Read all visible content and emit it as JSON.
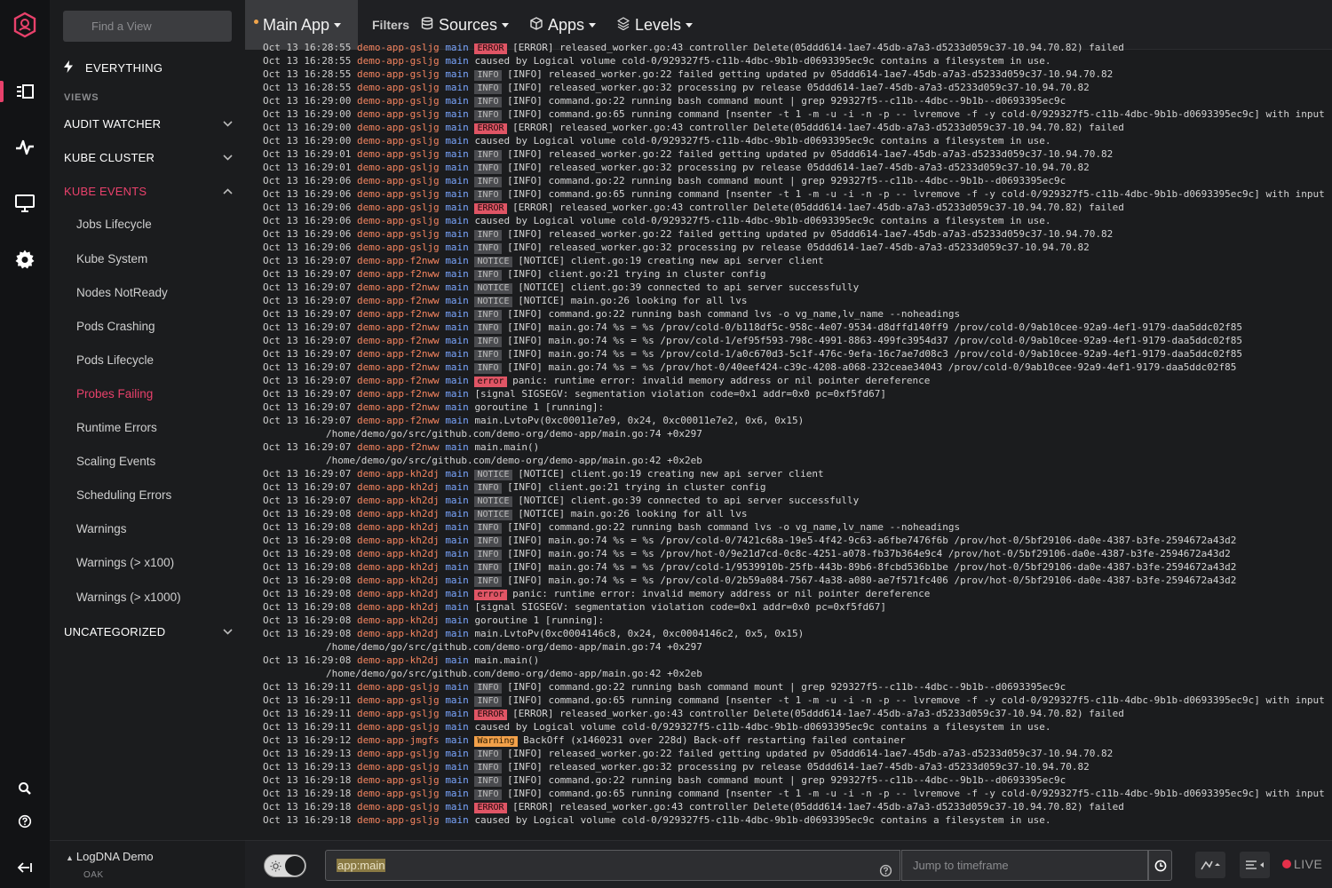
{
  "nav": {
    "find_placeholder": "Find a View",
    "everything_label": "EVERYTHING",
    "views_header": "VIEWS"
  },
  "categories": [
    {
      "label": "AUDIT WATCHER",
      "open": false
    },
    {
      "label": "KUBE CLUSTER",
      "open": false
    },
    {
      "label": "KUBE EVENTS",
      "open": true
    },
    {
      "label": "UNCATEGORIZED",
      "open": false
    }
  ],
  "kube_events_views": [
    {
      "label": "Jobs Lifecycle"
    },
    {
      "label": "Kube System"
    },
    {
      "label": "Nodes NotReady"
    },
    {
      "label": "Pods Crashing"
    },
    {
      "label": "Pods Lifecycle"
    },
    {
      "label": "Probes Failing",
      "active": true
    },
    {
      "label": "Runtime Errors"
    },
    {
      "label": "Scaling Events"
    },
    {
      "label": "Scheduling Errors"
    },
    {
      "label": "Warnings"
    },
    {
      "label": "Warnings (> x100)"
    },
    {
      "label": "Warnings (> x1000)"
    }
  ],
  "account": {
    "name": "LogDNA Demo",
    "region": "OAK"
  },
  "topbar": {
    "view_name": "Main App",
    "filters_label": "Filters",
    "sources_label": "Sources",
    "apps_label": "Apps",
    "levels_label": "Levels"
  },
  "logs": [
    {
      "ts": "Oct 13 16:28:55",
      "host": "demo-app-gsljg",
      "app": "main",
      "level": "ERROR",
      "msg": "[ERROR] released_worker.go:43 controller Delete(05ddd614-1ae7-45db-a7a3-d5233d059c37-10.94.70.82) failed"
    },
    {
      "ts": "Oct 13 16:28:55",
      "host": "demo-app-gsljg",
      "app": "main",
      "level": "",
      "msg": "caused by   Logical volume cold-0/929327f5-c11b-4dbc-9b1b-d0693395ec9c contains a filesystem in use."
    },
    {
      "ts": "Oct 13 16:28:55",
      "host": "demo-app-gsljg",
      "app": "main",
      "level": "INFO",
      "msg": "[INFO] released_worker.go:22 failed getting updated pv 05ddd614-1ae7-45db-a7a3-d5233d059c37-10.94.70.82"
    },
    {
      "ts": "Oct 13 16:28:55",
      "host": "demo-app-gsljg",
      "app": "main",
      "level": "INFO",
      "msg": "[INFO] released_worker.go:32 processing pv release 05ddd614-1ae7-45db-a7a3-d5233d059c37-10.94.70.82"
    },
    {
      "ts": "Oct 13 16:29:00",
      "host": "demo-app-gsljg",
      "app": "main",
      "level": "INFO",
      "msg": "[INFO] command.go:22 running bash command mount | grep 929327f5--c11b--4dbc--9b1b--d0693395ec9c"
    },
    {
      "ts": "Oct 13 16:29:00",
      "host": "demo-app-gsljg",
      "app": "main",
      "level": "INFO",
      "msg": "[INFO] command.go:65 running command [nsenter -t 1 -m -u -i -n -p -- lvremove -f -y cold-0/929327f5-c11b-4dbc-9b1b-d0693395ec9c] with input"
    },
    {
      "ts": "Oct 13 16:29:00",
      "host": "demo-app-gsljg",
      "app": "main",
      "level": "ERROR",
      "msg": "[ERROR] released_worker.go:43 controller Delete(05ddd614-1ae7-45db-a7a3-d5233d059c37-10.94.70.82) failed"
    },
    {
      "ts": "Oct 13 16:29:00",
      "host": "demo-app-gsljg",
      "app": "main",
      "level": "",
      "msg": "caused by   Logical volume cold-0/929327f5-c11b-4dbc-9b1b-d0693395ec9c contains a filesystem in use."
    },
    {
      "ts": "Oct 13 16:29:01",
      "host": "demo-app-gsljg",
      "app": "main",
      "level": "INFO",
      "msg": "[INFO] released_worker.go:22 failed getting updated pv 05ddd614-1ae7-45db-a7a3-d5233d059c37-10.94.70.82"
    },
    {
      "ts": "Oct 13 16:29:01",
      "host": "demo-app-gsljg",
      "app": "main",
      "level": "INFO",
      "msg": "[INFO] released_worker.go:32 processing pv release 05ddd614-1ae7-45db-a7a3-d5233d059c37-10.94.70.82"
    },
    {
      "ts": "Oct 13 16:29:06",
      "host": "demo-app-gsljg",
      "app": "main",
      "level": "INFO",
      "msg": "[INFO] command.go:22 running bash command mount | grep 929327f5--c11b--4dbc--9b1b--d0693395ec9c"
    },
    {
      "ts": "Oct 13 16:29:06",
      "host": "demo-app-gsljg",
      "app": "main",
      "level": "INFO",
      "msg": "[INFO] command.go:65 running command [nsenter -t 1 -m -u -i -n -p -- lvremove -f -y cold-0/929327f5-c11b-4dbc-9b1b-d0693395ec9c] with input"
    },
    {
      "ts": "Oct 13 16:29:06",
      "host": "demo-app-gsljg",
      "app": "main",
      "level": "ERROR",
      "msg": "[ERROR] released_worker.go:43 controller Delete(05ddd614-1ae7-45db-a7a3-d5233d059c37-10.94.70.82) failed"
    },
    {
      "ts": "Oct 13 16:29:06",
      "host": "demo-app-gsljg",
      "app": "main",
      "level": "",
      "msg": "caused by   Logical volume cold-0/929327f5-c11b-4dbc-9b1b-d0693395ec9c contains a filesystem in use."
    },
    {
      "ts": "Oct 13 16:29:06",
      "host": "demo-app-gsljg",
      "app": "main",
      "level": "INFO",
      "msg": "[INFO] released_worker.go:22 failed getting updated pv 05ddd614-1ae7-45db-a7a3-d5233d059c37-10.94.70.82"
    },
    {
      "ts": "Oct 13 16:29:06",
      "host": "demo-app-gsljg",
      "app": "main",
      "level": "INFO",
      "msg": "[INFO] released_worker.go:32 processing pv release 05ddd614-1ae7-45db-a7a3-d5233d059c37-10.94.70.82"
    },
    {
      "ts": "Oct 13 16:29:07",
      "host": "demo-app-f2nww",
      "app": "main",
      "level": "NOTICE",
      "msg": "[NOTICE] client.go:19 creating new api server client"
    },
    {
      "ts": "Oct 13 16:29:07",
      "host": "demo-app-f2nww",
      "app": "main",
      "level": "INFO",
      "msg": "[INFO] client.go:21 trying in cluster config"
    },
    {
      "ts": "Oct 13 16:29:07",
      "host": "demo-app-f2nww",
      "app": "main",
      "level": "NOTICE",
      "msg": "[NOTICE] client.go:39 connected to api server successfully"
    },
    {
      "ts": "Oct 13 16:29:07",
      "host": "demo-app-f2nww",
      "app": "main",
      "level": "NOTICE",
      "msg": "[NOTICE] main.go:26 looking for all lvs"
    },
    {
      "ts": "Oct 13 16:29:07",
      "host": "demo-app-f2nww",
      "app": "main",
      "level": "INFO",
      "msg": "[INFO] command.go:22 running bash command lvs -o vg_name,lv_name --noheadings"
    },
    {
      "ts": "Oct 13 16:29:07",
      "host": "demo-app-f2nww",
      "app": "main",
      "level": "INFO",
      "msg": "[INFO] main.go:74 %s = %s /prov/cold-0/b118df5c-958c-4e07-9534-d8dffd140ff9 /prov/cold-0/9ab10cee-92a9-4ef1-9179-daa5ddc02f85"
    },
    {
      "ts": "Oct 13 16:29:07",
      "host": "demo-app-f2nww",
      "app": "main",
      "level": "INFO",
      "msg": "[INFO] main.go:74 %s = %s /prov/cold-1/ef95f593-798c-4991-8863-499fc3954d37 /prov/cold-0/9ab10cee-92a9-4ef1-9179-daa5ddc02f85"
    },
    {
      "ts": "Oct 13 16:29:07",
      "host": "demo-app-f2nww",
      "app": "main",
      "level": "INFO",
      "msg": "[INFO] main.go:74 %s = %s /prov/cold-1/a0c670d3-5c1f-476c-9efa-16c7ae7d08c3 /prov/cold-0/9ab10cee-92a9-4ef1-9179-daa5ddc02f85"
    },
    {
      "ts": "Oct 13 16:29:07",
      "host": "demo-app-f2nww",
      "app": "main",
      "level": "INFO",
      "msg": "[INFO] main.go:74 %s = %s /prov/hot-0/40eef424-c39c-4208-a068-232ceae34043 /prov/cold-0/9ab10cee-92a9-4ef1-9179-daa5ddc02f85"
    },
    {
      "ts": "Oct 13 16:29:07",
      "host": "demo-app-f2nww",
      "app": "main",
      "level": "error",
      "msg": "panic: runtime error: invalid memory address or nil pointer dereference"
    },
    {
      "ts": "Oct 13 16:29:07",
      "host": "demo-app-f2nww",
      "app": "main",
      "level": "",
      "msg": "[signal SIGSEGV: segmentation violation code=0x1 addr=0x0 pc=0xf5fd67]"
    },
    {
      "ts": "Oct 13 16:29:07",
      "host": "demo-app-f2nww",
      "app": "main",
      "level": "",
      "msg": "goroutine 1 [running]:"
    },
    {
      "ts": "Oct 13 16:29:07",
      "host": "demo-app-f2nww",
      "app": "main",
      "level": "",
      "msg": "main.LvtoPv(0xc00011e7e9, 0x24, 0xc00011e7e2, 0x6, 0x15)"
    },
    {
      "cont": "/home/demo/go/src/github.com/demo-org/demo-app/main.go:74 +0x297"
    },
    {
      "ts": "Oct 13 16:29:07",
      "host": "demo-app-f2nww",
      "app": "main",
      "level": "",
      "msg": "main.main()"
    },
    {
      "cont": "/home/demo/go/src/github.com/demo-org/demo-app/main.go:42 +0x2eb"
    },
    {
      "ts": "Oct 13 16:29:07",
      "host": "demo-app-kh2dj",
      "app": "main",
      "level": "NOTICE",
      "msg": "[NOTICE] client.go:19 creating new api server client"
    },
    {
      "ts": "Oct 13 16:29:07",
      "host": "demo-app-kh2dj",
      "app": "main",
      "level": "INFO",
      "msg": "[INFO] client.go:21 trying in cluster config"
    },
    {
      "ts": "Oct 13 16:29:07",
      "host": "demo-app-kh2dj",
      "app": "main",
      "level": "NOTICE",
      "msg": "[NOTICE] client.go:39 connected to api server successfully"
    },
    {
      "ts": "Oct 13 16:29:08",
      "host": "demo-app-kh2dj",
      "app": "main",
      "level": "NOTICE",
      "msg": "[NOTICE] main.go:26 looking for all lvs"
    },
    {
      "ts": "Oct 13 16:29:08",
      "host": "demo-app-kh2dj",
      "app": "main",
      "level": "INFO",
      "msg": "[INFO] command.go:22 running bash command lvs -o vg_name,lv_name --noheadings"
    },
    {
      "ts": "Oct 13 16:29:08",
      "host": "demo-app-kh2dj",
      "app": "main",
      "level": "INFO",
      "msg": "[INFO] main.go:74 %s = %s /prov/cold-0/7421c68a-19e5-4f42-9c63-a6fbe7476f6b /prov/hot-0/5bf29106-da0e-4387-b3fe-2594672a43d2"
    },
    {
      "ts": "Oct 13 16:29:08",
      "host": "demo-app-kh2dj",
      "app": "main",
      "level": "INFO",
      "msg": "[INFO] main.go:74 %s = %s /prov/hot-0/9e21d7cd-0c8c-4251-a078-fb37b364e9c4 /prov/hot-0/5bf29106-da0e-4387-b3fe-2594672a43d2"
    },
    {
      "ts": "Oct 13 16:29:08",
      "host": "demo-app-kh2dj",
      "app": "main",
      "level": "INFO",
      "msg": "[INFO] main.go:74 %s = %s /prov/cold-1/9539910b-25fb-443b-89b6-8fcbd536b1be /prov/hot-0/5bf29106-da0e-4387-b3fe-2594672a43d2"
    },
    {
      "ts": "Oct 13 16:29:08",
      "host": "demo-app-kh2dj",
      "app": "main",
      "level": "INFO",
      "msg": "[INFO] main.go:74 %s = %s /prov/cold-0/2b59a084-7567-4a38-a080-ae7f571fc406 /prov/hot-0/5bf29106-da0e-4387-b3fe-2594672a43d2"
    },
    {
      "ts": "Oct 13 16:29:08",
      "host": "demo-app-kh2dj",
      "app": "main",
      "level": "error",
      "msg": "panic: runtime error: invalid memory address or nil pointer dereference"
    },
    {
      "ts": "Oct 13 16:29:08",
      "host": "demo-app-kh2dj",
      "app": "main",
      "level": "",
      "msg": "[signal SIGSEGV: segmentation violation code=0x1 addr=0x0 pc=0xf5fd67]"
    },
    {
      "ts": "Oct 13 16:29:08",
      "host": "demo-app-kh2dj",
      "app": "main",
      "level": "",
      "msg": "goroutine 1 [running]:"
    },
    {
      "ts": "Oct 13 16:29:08",
      "host": "demo-app-kh2dj",
      "app": "main",
      "level": "",
      "msg": "main.LvtoPv(0xc0004146c8, 0x24, 0xc0004146c2, 0x5, 0x15)"
    },
    {
      "cont": "/home/demo/go/src/github.com/demo-org/demo-app/main.go:74 +0x297"
    },
    {
      "ts": "Oct 13 16:29:08",
      "host": "demo-app-kh2dj",
      "app": "main",
      "level": "",
      "msg": "main.main()"
    },
    {
      "cont": "/home/demo/go/src/github.com/demo-org/demo-app/main.go:42 +0x2eb"
    },
    {
      "ts": "Oct 13 16:29:11",
      "host": "demo-app-gsljg",
      "app": "main",
      "level": "INFO",
      "msg": "[INFO] command.go:22 running bash command mount | grep 929327f5--c11b--4dbc--9b1b--d0693395ec9c"
    },
    {
      "ts": "Oct 13 16:29:11",
      "host": "demo-app-gsljg",
      "app": "main",
      "level": "INFO",
      "msg": "[INFO] command.go:65 running command [nsenter -t 1 -m -u -i -n -p -- lvremove -f -y cold-0/929327f5-c11b-4dbc-9b1b-d0693395ec9c] with input"
    },
    {
      "ts": "Oct 13 16:29:11",
      "host": "demo-app-gsljg",
      "app": "main",
      "level": "ERROR",
      "msg": "[ERROR] released_worker.go:43 controller Delete(05ddd614-1ae7-45db-a7a3-d5233d059c37-10.94.70.82) failed"
    },
    {
      "ts": "Oct 13 16:29:11",
      "host": "demo-app-gsljg",
      "app": "main",
      "level": "",
      "msg": "caused by   Logical volume cold-0/929327f5-c11b-4dbc-9b1b-d0693395ec9c contains a filesystem in use."
    },
    {
      "ts": "Oct 13 16:29:12",
      "host": "demo-app-jmgfs",
      "app": "main",
      "level": "Warning",
      "msg": "BackOff  (x1460231 over 228d)  Back-off restarting failed container"
    },
    {
      "ts": "Oct 13 16:29:13",
      "host": "demo-app-gsljg",
      "app": "main",
      "level": "INFO",
      "msg": "[INFO] released_worker.go:22 failed getting updated pv 05ddd614-1ae7-45db-a7a3-d5233d059c37-10.94.70.82"
    },
    {
      "ts": "Oct 13 16:29:13",
      "host": "demo-app-gsljg",
      "app": "main",
      "level": "INFO",
      "msg": "[INFO] released_worker.go:32 processing pv release 05ddd614-1ae7-45db-a7a3-d5233d059c37-10.94.70.82"
    },
    {
      "ts": "Oct 13 16:29:18",
      "host": "demo-app-gsljg",
      "app": "main",
      "level": "INFO",
      "msg": "[INFO] command.go:22 running bash command mount | grep 929327f5--c11b--4dbc--9b1b--d0693395ec9c"
    },
    {
      "ts": "Oct 13 16:29:18",
      "host": "demo-app-gsljg",
      "app": "main",
      "level": "INFO",
      "msg": "[INFO] command.go:65 running command [nsenter -t 1 -m -u -i -n -p -- lvremove -f -y cold-0/929327f5-c11b-4dbc-9b1b-d0693395ec9c] with input"
    },
    {
      "ts": "Oct 13 16:29:18",
      "host": "demo-app-gsljg",
      "app": "main",
      "level": "ERROR",
      "msg": "[ERROR] released_worker.go:43 controller Delete(05ddd614-1ae7-45db-a7a3-d5233d059c37-10.94.70.82) failed"
    },
    {
      "ts": "Oct 13 16:29:18",
      "host": "demo-app-gsljg",
      "app": "main",
      "level": "",
      "msg": "caused by   Logical volume cold-0/929327f5-c11b-4dbc-9b1b-d0693395ec9c contains a filesystem in use."
    }
  ],
  "bottombar": {
    "query": "app:main",
    "jump_placeholder": "Jump to timeframe",
    "live_label": "LIVE"
  },
  "colors": {
    "accent": "#e8416b",
    "host": "#f4845f",
    "app": "#7aa6ff",
    "error": "#e05565",
    "warning": "#f3a14a",
    "info": "#4a4b4f",
    "live": "#e5304a"
  },
  "icons": [
    "logo-icon",
    "views-icon",
    "pulse-icon",
    "monitor-icon",
    "gear-icon",
    "search-icon",
    "help-icon",
    "collapse-icon",
    "bolt-icon",
    "chevron-down-icon",
    "chevron-up-icon",
    "database-icon",
    "box-icon",
    "layers-icon",
    "sun-icon",
    "clock-icon",
    "graph-icon",
    "context-icon"
  ]
}
